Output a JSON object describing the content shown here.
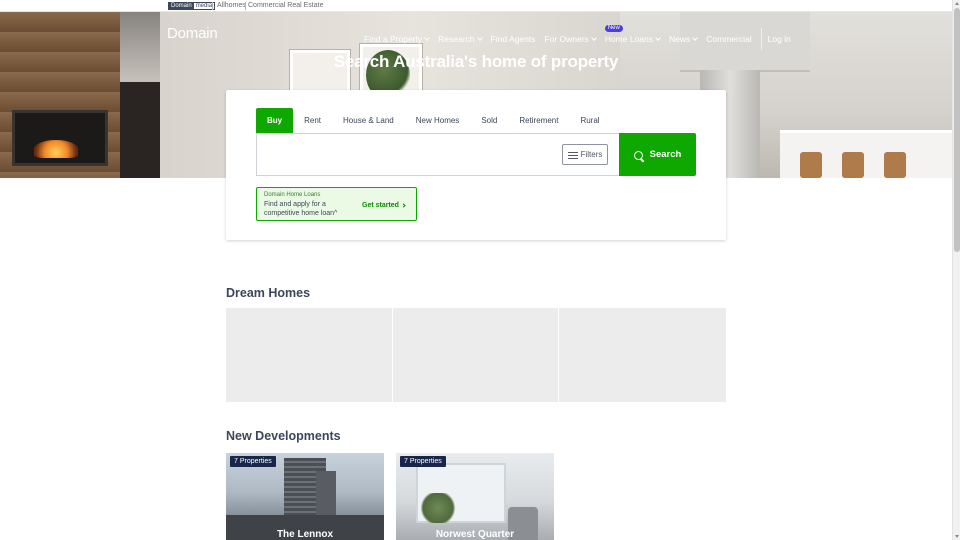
{
  "topbar": {
    "logo_left": "Domain",
    "logo_right": "media",
    "links": [
      "Allhomes",
      "Commercial Real Estate"
    ]
  },
  "header": {
    "brand": "Domain",
    "nav": [
      {
        "label": "Find a Property",
        "dropdown": true
      },
      {
        "label": "Research",
        "dropdown": true
      },
      {
        "label": "Find Agents",
        "dropdown": false
      },
      {
        "label": "For Owners",
        "dropdown": true
      },
      {
        "label": "Home Loans",
        "dropdown": true,
        "badge": "New"
      },
      {
        "label": "News",
        "dropdown": true
      },
      {
        "label": "Commercial",
        "dropdown": false
      }
    ],
    "login": "Log in"
  },
  "hero": {
    "title": "Search Australia's home of property"
  },
  "search": {
    "tabs": [
      "Buy",
      "Rent",
      "House & Land",
      "New Homes",
      "Sold",
      "Retirement",
      "Rural"
    ],
    "active_tab": "Buy",
    "input_value": "",
    "filters_label": "Filters",
    "button_label": "Search"
  },
  "promo": {
    "eyebrow": "Domain Home Loans",
    "text": "Find and apply for a competitive home loan^",
    "cta": "Get started"
  },
  "sections": {
    "dream_homes": "Dream Homes",
    "new_developments": "New Developments"
  },
  "developments": [
    {
      "count": "7 Properties",
      "name": "The Lennox"
    },
    {
      "count": "7 Properties",
      "name": "Norwest Quarter"
    }
  ],
  "colors": {
    "brand_green": "#0ea800",
    "text_dark": "#3c475b",
    "badge_purple": "#4a3ee0",
    "count_navy": "#17264a"
  }
}
